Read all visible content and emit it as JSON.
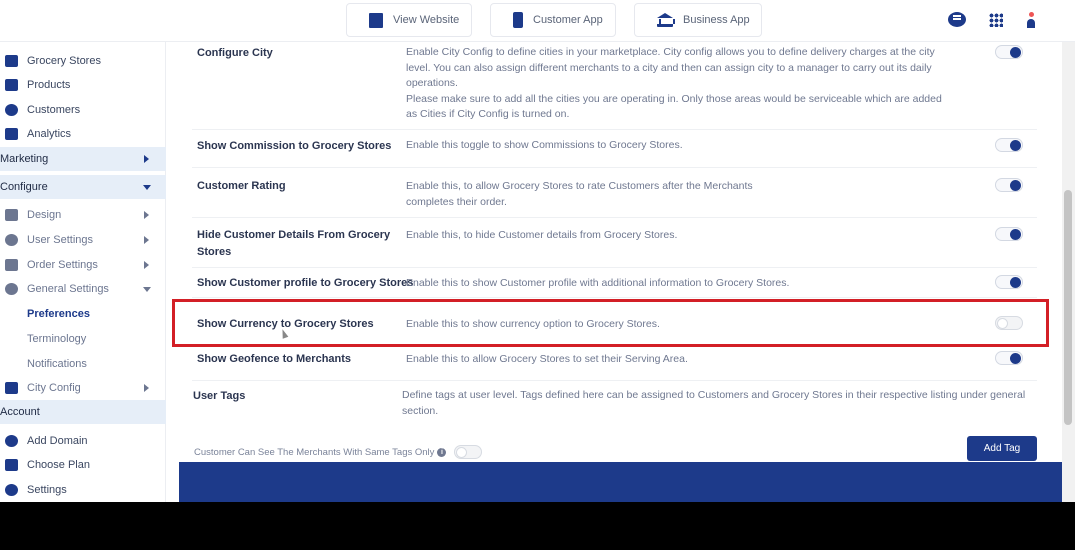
{
  "topbar": {
    "view_website": "View Website",
    "customer_app": "Customer App",
    "business_app": "Business App"
  },
  "sidebar": {
    "items": [
      {
        "label": "Grocery Stores",
        "icon": "store-icon"
      },
      {
        "label": "Products",
        "icon": "products-icon"
      },
      {
        "label": "Customers",
        "icon": "customers-icon"
      },
      {
        "label": "Analytics",
        "icon": "analytics-icon"
      },
      {
        "label": "Marketing",
        "section": true
      },
      {
        "label": "Configure",
        "section": true
      },
      {
        "label": "Design",
        "icon": "design-icon"
      },
      {
        "label": "User Settings",
        "icon": "user-settings-icon"
      },
      {
        "label": "Order Settings",
        "icon": "order-settings-icon"
      },
      {
        "label": "General Settings",
        "icon": "gear-icon"
      },
      {
        "label": "Preferences",
        "sub": true,
        "active": true
      },
      {
        "label": "Terminology",
        "sub": true
      },
      {
        "label": "Notifications",
        "sub": true
      },
      {
        "label": "City Config",
        "icon": "city-icon"
      },
      {
        "label": "Account",
        "section": true
      },
      {
        "label": "Add Domain",
        "icon": "domain-icon"
      },
      {
        "label": "Choose Plan",
        "icon": "plan-icon"
      },
      {
        "label": "Settings",
        "icon": "settings-icon"
      }
    ]
  },
  "settings": [
    {
      "title": "Configure City",
      "desc1": "Enable City Config to define cities in your marketplace. City config allows you to define delivery charges at the city level. You can also assign different merchants to a city and then can assign city to a manager to carry out its daily operations.",
      "desc2": "Please make sure to add all the cities you are operating in. Only those areas would be serviceable which are added as Cities if City Config is turned on.",
      "enabled": true
    },
    {
      "title": "Show Commission to Grocery Stores",
      "desc1": "Enable this toggle to show Commissions to Grocery Stores.",
      "enabled": true
    },
    {
      "title": "Customer Rating",
      "desc1": "Enable this, to allow Grocery Stores to rate Customers after the Merchants completes their order.",
      "enabled": true
    },
    {
      "title": "Hide Customer Details From Grocery Stores",
      "desc1": "Enable this, to hide Customer details from Grocery Stores.",
      "enabled": true
    },
    {
      "title": "Show Customer profile to Grocery Stores",
      "desc1": "Enable this to show Customer profile with additional information to Grocery Stores.",
      "enabled": true
    },
    {
      "title": "Show Currency to Grocery Stores",
      "desc1": "Enable this to show currency option to Grocery Stores.",
      "enabled": false
    },
    {
      "title": "Show Geofence to Merchants",
      "desc1": "Enable this to allow Grocery Stores to set their Serving Area.",
      "enabled": true
    },
    {
      "title": "User Tags",
      "desc1": "Define tags at user level. Tags defined here can be assigned to Customers and Grocery Stores in their respective listing under general section."
    }
  ],
  "tags": {
    "same_tags_label": "Customer Can See The Merchants With Same Tags Only",
    "same_tags_enabled": false,
    "add_tag_label": "Add Tag"
  },
  "colors": {
    "brand": "#1d3a8a",
    "highlight": "#d31f26"
  }
}
